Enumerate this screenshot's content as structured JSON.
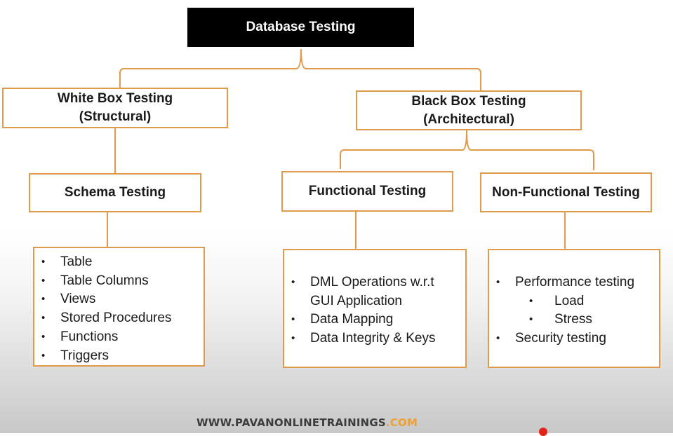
{
  "root": {
    "label": "Database Testing"
  },
  "white_box": {
    "line1": "White Box Testing",
    "line2": "(Structural)"
  },
  "black_box": {
    "line1": "Black Box Testing",
    "line2": "(Architectural)"
  },
  "schema": {
    "label": "Schema Testing"
  },
  "functional": {
    "label": "Functional Testing"
  },
  "nonfunctional": {
    "label": "Non-Functional Testing"
  },
  "schema_items": [
    "Table",
    "Table Columns",
    "Views",
    "Stored Procedures",
    "Functions",
    "Triggers"
  ],
  "functional_items": [
    "DML Operations w.r.t",
    "GUI Application",
    "Data Mapping",
    "Data Integrity & Keys"
  ],
  "nonfunctional_items": [
    "Performance testing",
    "Load",
    "Stress",
    "Security testing"
  ],
  "footer": {
    "main": "WWW.PAVANONLINETRAININGS",
    "ext": ".COM"
  },
  "colors": {
    "box_border": "#e09a4b",
    "root_bg": "#000000",
    "footer_ext": "#f0a030"
  }
}
